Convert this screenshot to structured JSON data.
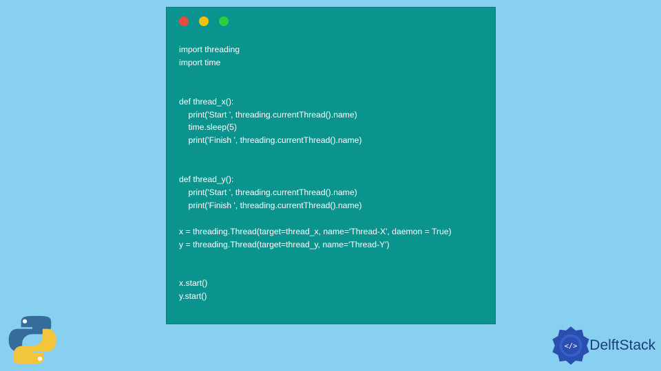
{
  "window": {
    "traffic_lights": [
      "red",
      "yellow",
      "green"
    ]
  },
  "code_lines": [
    "import threading",
    "import time",
    "",
    "",
    "def thread_x():",
    "    print('Start ', threading.currentThread().name)",
    "    time.sleep(5)",
    "    print('Finish ', threading.currentThread().name)",
    "",
    "",
    "def thread_y():",
    "    print('Start ', threading.currentThread().name)",
    "    print('Finish ', threading.currentThread().name)",
    "",
    "x = threading.Thread(target=thread_x, name='Thread-X', daemon = True)",
    "y = threading.Thread(target=thread_y, name='Thread-Y')",
    "",
    "",
    "x.start()",
    "y.start()"
  ],
  "branding": {
    "site_name": "DelftStack"
  },
  "icons": {
    "python": "python-logo-icon",
    "delft_badge": "delftstack-badge-icon"
  }
}
